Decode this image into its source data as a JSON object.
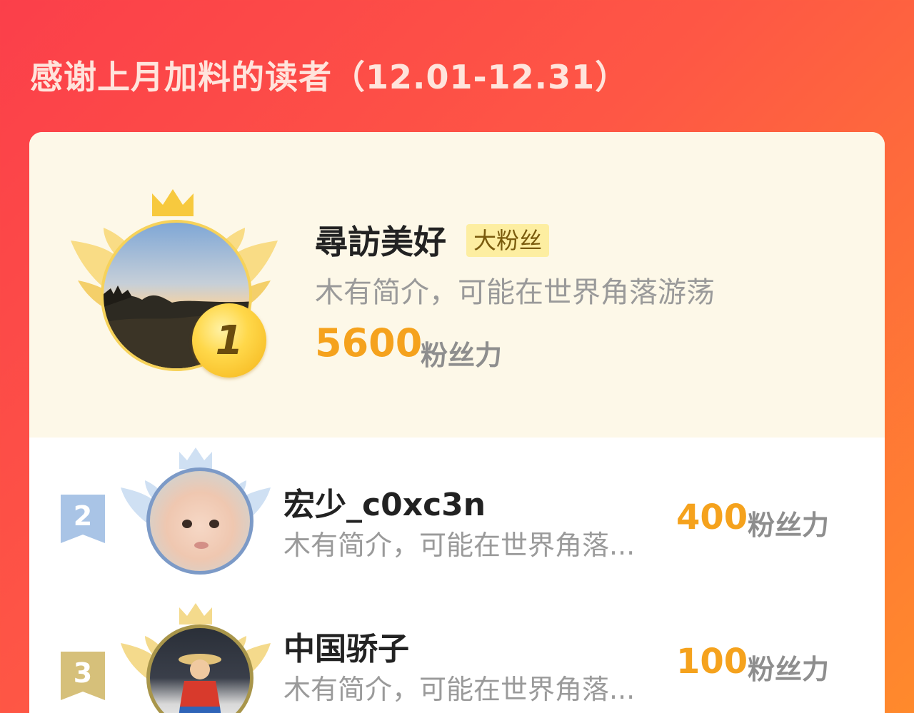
{
  "page": {
    "title": "感谢上月加料的读者（12.01-12.31）"
  },
  "top_reader": {
    "rank": "1",
    "name": "尋訪美好",
    "badge": "大粉丝",
    "bio": "木有简介，可能在世界角落游荡",
    "score": "5600",
    "score_unit": "粉丝力",
    "crown_color": "#f7c93e",
    "wing_color": "#f9dc85"
  },
  "readers": [
    {
      "rank": "2",
      "name": "宏少_c0xc3n",
      "bio": "木有简介，可能在世界角落...",
      "score": "400",
      "score_unit": "粉丝力",
      "ribbon_color": "#a9c4e6",
      "ring_color": "#7c9ac7"
    },
    {
      "rank": "3",
      "name": "中国骄子",
      "bio": "木有简介，可能在世界角落...",
      "score": "100",
      "score_unit": "粉丝力",
      "ribbon_color": "#d6c07a",
      "ring_color": "#a8954a"
    }
  ],
  "colors": {
    "accent_orange": "#f5a21d",
    "header_gradient_start": "#fb3f4a",
    "header_gradient_end": "#ff8a2c",
    "top_section_bg": "#fdf8e8"
  }
}
